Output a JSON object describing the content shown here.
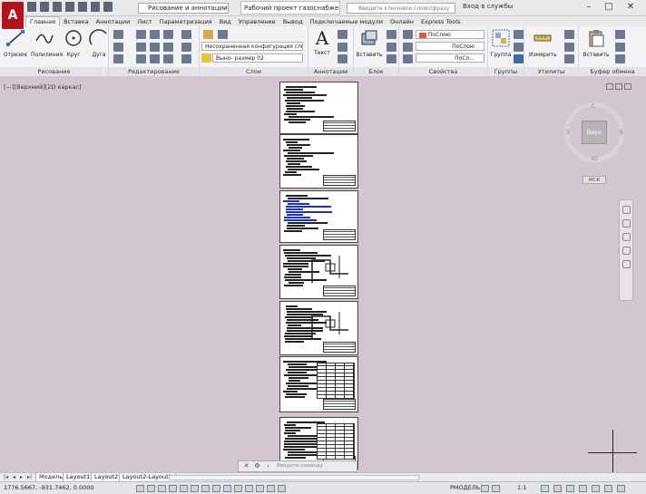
{
  "app": {
    "logo_letter": "A"
  },
  "title_bar": {
    "workspace": "Рисование и аннотации",
    "document_title": "Рабочий проект газоснабжения...",
    "search_placeholder": "Введите ключевое слово/фразу",
    "sign_in": "Вход в службы"
  },
  "tabs": [
    "Главная",
    "Вставка",
    "Аннотации",
    "Лист",
    "Параметризация",
    "Вид",
    "Управление",
    "Вывод",
    "Подключаемые модули",
    "Онлайн",
    "Express Tools"
  ],
  "ribbon": {
    "draw": {
      "title": "Рисование",
      "tools": [
        "Отрезок",
        "Полилиния",
        "Круг",
        "Дуга"
      ]
    },
    "modify": {
      "title": "Редактирование"
    },
    "layers": {
      "title": "Слои",
      "config": "Несохраненная конфигурация сло",
      "layer": "Выно- размер 02"
    },
    "annotation": {
      "title": "Аннотации",
      "tool": "Текст"
    },
    "block": {
      "title": "Блок",
      "tool": "Вставить"
    },
    "properties": {
      "title": "Свойства",
      "color": "ПоСлою",
      "linetype": "ПоСлою",
      "lineweight": "ПоСл..."
    },
    "groups": {
      "title": "Группы",
      "tool": "Группа"
    },
    "utilities": {
      "title": "Утилиты",
      "tool": "Измерить"
    },
    "clipboard": {
      "title": "Буфер обмена",
      "tool": "Вставить"
    }
  },
  "viewport": {
    "label": "[—][Верхний][2D каркас]",
    "viewcube_face": "Верх",
    "dir_n": "С",
    "dir_s": "Ю",
    "dir_w": "З",
    "dir_e": "В",
    "wcs": "МСК"
  },
  "command_line": {
    "placeholder": "Введите команду"
  },
  "layout_tabs": [
    "Модель",
    "Layout1",
    "Layout2",
    "Layout2-Layout1"
  ],
  "status_bar": {
    "coords": "1776.5667, -931.7462, 0.0000",
    "model": "РМОДЕЛЬ",
    "scale": "1:1"
  }
}
